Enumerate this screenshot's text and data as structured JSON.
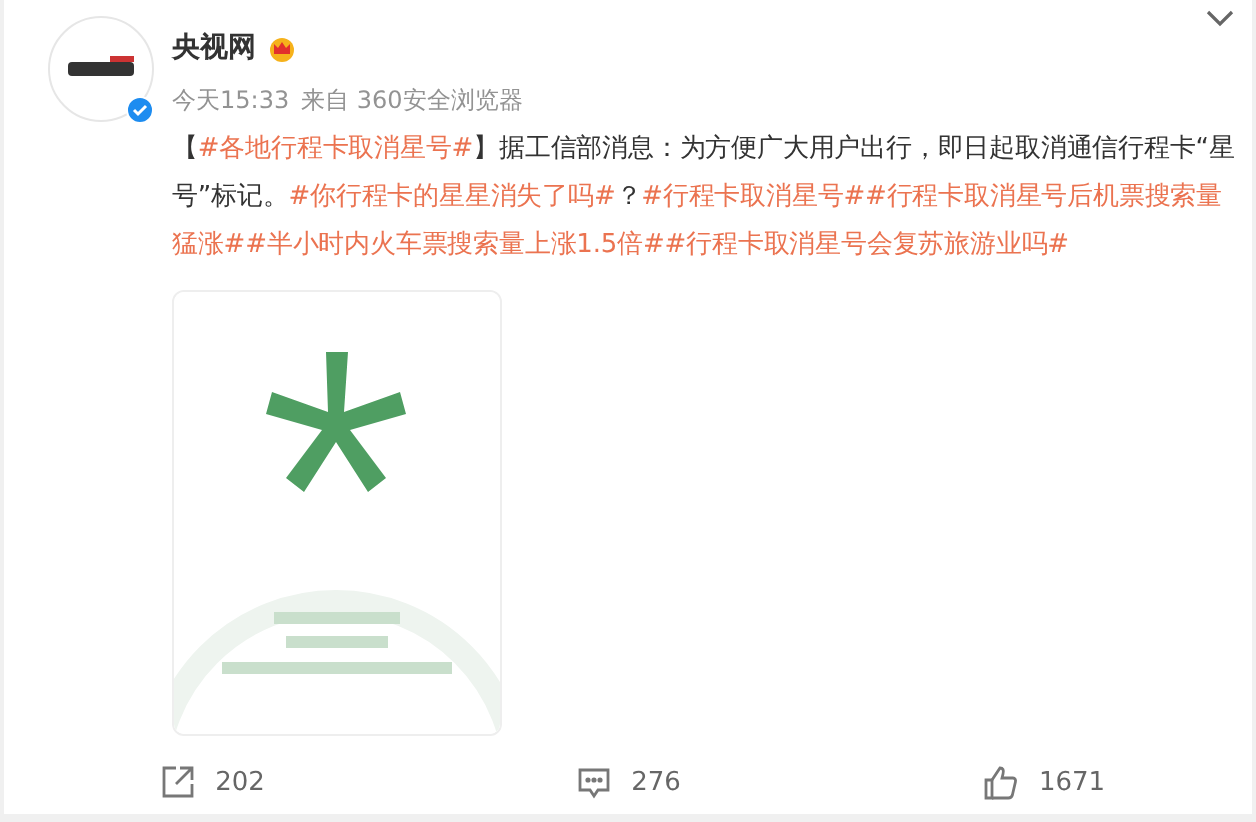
{
  "author": {
    "name": "央视网",
    "verified": true,
    "time": "今天15:33",
    "source": "来自 360安全浏览器"
  },
  "body": [
    {
      "kind": "plain",
      "text": "【"
    },
    {
      "kind": "topic",
      "text": "#各地行程卡取消星号#"
    },
    {
      "kind": "plain",
      "text": "】据工信部消息：为方便广大用户出行，即日起取消通信行程卡“星号”标记。"
    },
    {
      "kind": "topic",
      "text": "#你行程卡的星星消失了吗#"
    },
    {
      "kind": "plain",
      "text": "？"
    },
    {
      "kind": "topic",
      "text": "#行程卡取消星号#"
    },
    {
      "kind": "topic",
      "text": "#行程卡取消星号后机票搜索量猛涨#"
    },
    {
      "kind": "topic",
      "text": "#半小时内火车票搜索量上涨1.5倍#"
    },
    {
      "kind": "topic",
      "text": "#行程卡取消星号会复苏旅游业吗#"
    }
  ],
  "actions": [
    {
      "kind": "share",
      "count": "202"
    },
    {
      "kind": "comment",
      "count": "276"
    },
    {
      "kind": "like",
      "count": "1671"
    }
  ]
}
